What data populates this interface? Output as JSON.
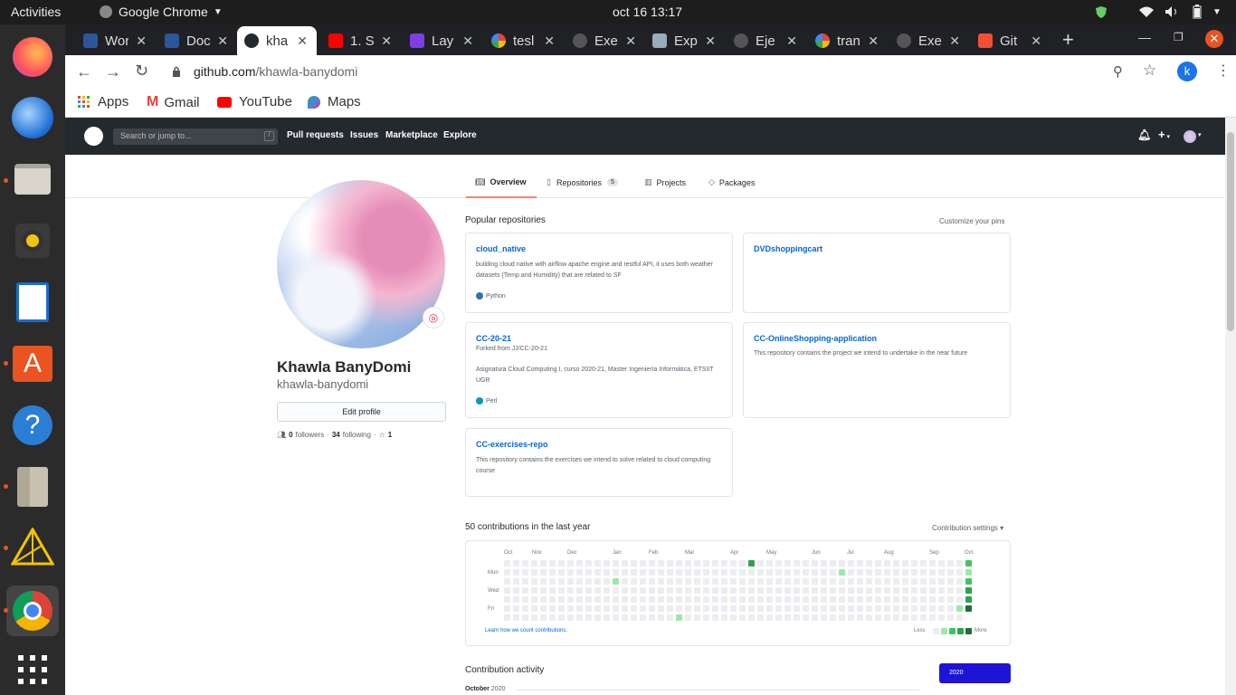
{
  "system": {
    "activities": "Activities",
    "app": "Google Chrome",
    "clock": "oct 16  13:17"
  },
  "tabs": [
    {
      "label": "Wor",
      "color": "#2b579a",
      "glyph": "W"
    },
    {
      "label": "Doc",
      "color": "#2b579a",
      "glyph": "W"
    },
    {
      "label": "kha",
      "color": "#ffffff",
      "glyph": "gh",
      "active": true
    },
    {
      "label": "1. Sc",
      "color": "#ff0000",
      "glyph": "yt"
    },
    {
      "label": "Lay",
      "color": "#7b3fe4",
      "glyph": "D"
    },
    {
      "label": "tesl",
      "color": "#ffffff",
      "glyph": "G"
    },
    {
      "label": "Exe",
      "color": "#24292e",
      "glyph": "gh"
    },
    {
      "label": "Exp",
      "color": "#9ab",
      "glyph": "gear"
    },
    {
      "label": "Eje",
      "color": "#24292e",
      "glyph": "gh"
    },
    {
      "label": "tran",
      "color": "#ffffff",
      "glyph": "G"
    },
    {
      "label": "Exe",
      "color": "#24292e",
      "glyph": "gh"
    },
    {
      "label": "Git",
      "color": "#f05133",
      "glyph": "git"
    }
  ],
  "address": {
    "host": "github.com",
    "path": "/khawla-banydomi",
    "profile_initial": "k"
  },
  "bookmarks": {
    "apps": "Apps",
    "gmail": "Gmail",
    "youtube": "YouTube",
    "maps": "Maps"
  },
  "gh_header": {
    "search_placeholder": "Search or jump to...",
    "slash": "/",
    "nav": [
      "Pull requests",
      "Issues",
      "Marketplace",
      "Explore"
    ],
    "plus": "+"
  },
  "profile_tabs": {
    "overview": "Overview",
    "repositories": "Repositories",
    "repo_count": "5",
    "projects": "Projects",
    "packages": "Packages"
  },
  "profile": {
    "name": "Khawla BanyDomi",
    "username": "khawla-banydomi",
    "edit": "Edit profile",
    "followers_count": "0",
    "followers": "followers",
    "following_count": "34",
    "following": "following",
    "stars": "1"
  },
  "popular": {
    "title": "Popular repositories",
    "customize": "Customize your pins"
  },
  "repos": [
    {
      "name": "cloud_native",
      "desc": "building cloud native with airflow apache engine and restful API, it uses both weather datasets (Temp and Humidity) that are related to SF",
      "lang": "Python",
      "lang_color": "#3572A5"
    },
    {
      "name": "DVDshoppingcart",
      "desc": "",
      "lang": "",
      "lang_color": ""
    },
    {
      "name": "CC-20-21",
      "fork": "Forked from JJ/CC-20-21",
      "desc": "Asignatura Cloud Computing I, curso 2020-21, Master Ingeniería Informática, ETSIIT UGR",
      "lang": "Perl",
      "lang_color": "#0298c3"
    },
    {
      "name": "CC-OnlineShopping-application",
      "desc": "This repository contains the project we intend to undertake in the near future",
      "lang": "",
      "lang_color": ""
    },
    {
      "name": "CC-exercises-repo",
      "desc": "This repository contains the exercises we intend to solve related to cloud computing course",
      "lang": "",
      "lang_color": ""
    }
  ],
  "contrib": {
    "title": "50 contributions in the last year",
    "settings": "Contribution settings",
    "months": [
      "Oct",
      "Nov",
      "Dec",
      "Jan",
      "Feb",
      "Mar",
      "Apr",
      "May",
      "Jun",
      "Jul",
      "Aug",
      "Sep",
      "Oct"
    ],
    "days": [
      "Mon",
      "Wed",
      "Fri"
    ],
    "learn": "Learn how we count contributions.",
    "less": "Less",
    "more": "More"
  },
  "activity": {
    "title": "Contribution activity",
    "year": "2020",
    "month": "October",
    "month_year": "2020"
  }
}
